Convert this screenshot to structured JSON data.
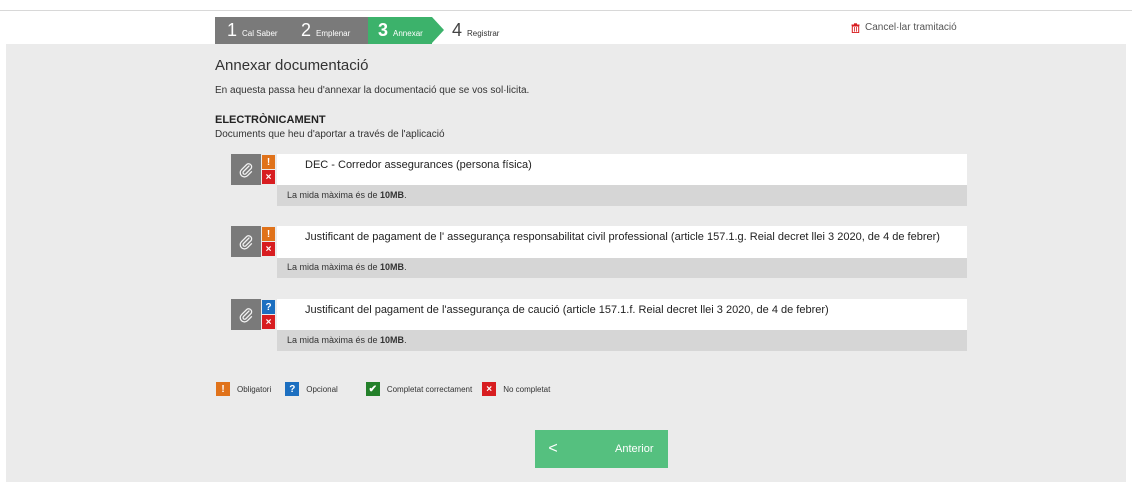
{
  "steps": [
    {
      "num": "1",
      "label": "Cal Saber"
    },
    {
      "num": "2",
      "label": "Emplenar"
    },
    {
      "num": "3",
      "label": "Annexar"
    },
    {
      "num": "4",
      "label": "Registrar"
    }
  ],
  "cancel_label": "Cancel·lar tramitació",
  "page": {
    "title": "Annexar documentació",
    "intro": "En aquesta passa heu d'annexar la documentació que se vos sol·licita.",
    "section_title": "ELECTRÒNICAMENT",
    "section_subtitle": "Documents que heu d'aportar a través de l'aplicació"
  },
  "documents": [
    {
      "name": "DEC - Corredor assegurances (persona física)",
      "type_badge": "!",
      "status_badge": "×",
      "size_prefix": "La mida màxima és de ",
      "size_value": "10MB",
      "size_suffix": "."
    },
    {
      "name": "Justificant de pagament de l' assegurança responsabilitat civil professional (article 157.1.g. Reial decret llei 3 2020, de 4 de febrer)",
      "type_badge": "!",
      "status_badge": "×",
      "size_prefix": "La mida màxima és de ",
      "size_value": "10MB",
      "size_suffix": "."
    },
    {
      "name": "Justificant del pagament de l'assegurança de caució (article 157.1.f. Reial decret llei 3 2020, de 4 de febrer)",
      "type_badge": "?",
      "status_badge": "×",
      "size_prefix": "La mida màxima és de ",
      "size_value": "10MB",
      "size_suffix": "."
    }
  ],
  "legend": {
    "mandatory": {
      "badge": "!",
      "label": "Obligatori"
    },
    "optional": {
      "badge": "?",
      "label": "Opcional"
    },
    "completed": {
      "badge": "✔",
      "label": "Completat correctament"
    },
    "not_completed": {
      "badge": "×",
      "label": "No completat"
    }
  },
  "previous_button": {
    "icon": "<",
    "label": "Anterior"
  },
  "colors": {
    "active_step": "#3cb26b",
    "button": "#55c07f",
    "mandatory": "#e0721a",
    "optional": "#1c6fc0",
    "error": "#d81d20",
    "ok": "#23802a"
  }
}
